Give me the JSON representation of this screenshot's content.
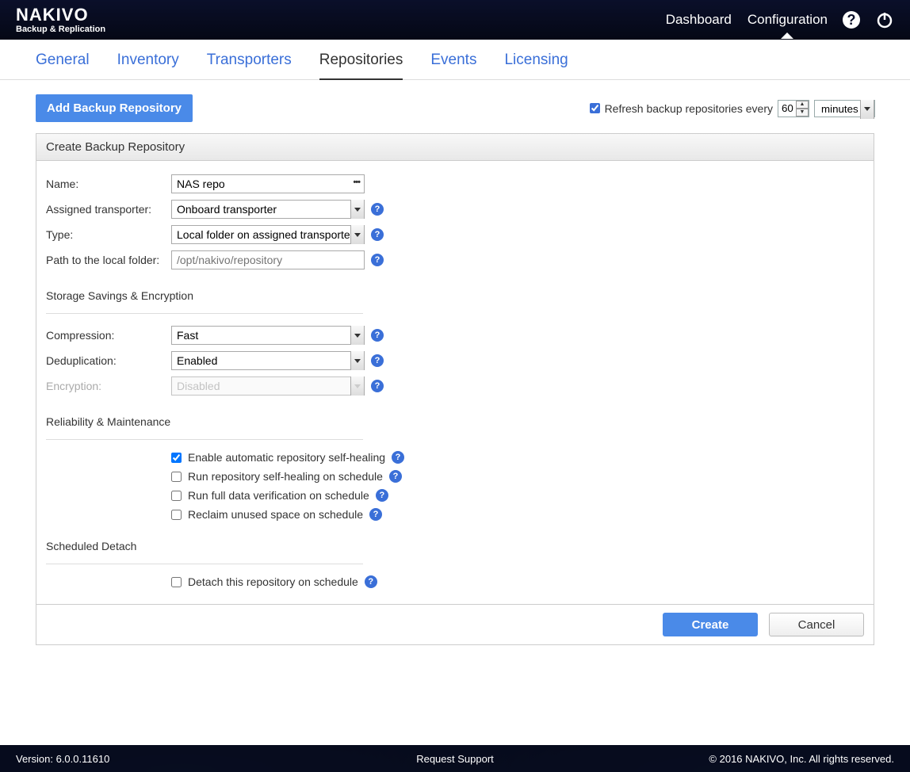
{
  "brand": {
    "name": "NAKIVO",
    "subtitle": "Backup & Replication"
  },
  "header": {
    "links": {
      "dashboard": "Dashboard",
      "configuration": "Configuration"
    }
  },
  "tabs": {
    "general": "General",
    "inventory": "Inventory",
    "transporters": "Transporters",
    "repositories": "Repositories",
    "events": "Events",
    "licensing": "Licensing"
  },
  "topbar": {
    "add_button": "Add Backup Repository",
    "refresh_label": "Refresh backup repositories every",
    "refresh_value": "60",
    "refresh_unit": "minutes"
  },
  "panel": {
    "title": "Create Backup Repository",
    "fields": {
      "name_label": "Name:",
      "name_value": "NAS repo",
      "transporter_label": "Assigned transporter:",
      "transporter_value": "Onboard transporter",
      "type_label": "Type:",
      "type_value": "Local folder on assigned transporter",
      "path_label": "Path to the local folder:",
      "path_placeholder": "/opt/nakivo/repository"
    },
    "sections": {
      "storage": "Storage Savings & Encryption",
      "compression_label": "Compression:",
      "compression_value": "Fast",
      "dedup_label": "Deduplication:",
      "dedup_value": "Enabled",
      "encryption_label": "Encryption:",
      "encryption_value": "Disabled",
      "reliability": "Reliability & Maintenance",
      "check_selfheal": "Enable automatic repository self-healing",
      "check_selfheal_sched": "Run repository self-healing on schedule",
      "check_verify": "Run full data verification on schedule",
      "check_reclaim": "Reclaim unused space on schedule",
      "scheduled_detach": "Scheduled Detach",
      "check_detach": "Detach this repository on schedule"
    },
    "buttons": {
      "create": "Create",
      "cancel": "Cancel"
    }
  },
  "footer": {
    "version_label": "Version: 6.0.0.11610",
    "support": "Request Support",
    "copyright": "© 2016 NAKIVO, Inc. All rights reserved."
  }
}
